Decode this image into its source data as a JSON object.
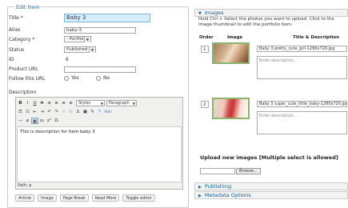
{
  "left": {
    "legend": "Edit Item",
    "fields": {
      "title_label": "Title",
      "title_req": "*",
      "title_value": "Baby 3",
      "alias_label": "Alias",
      "alias_value": "baby-3",
      "category_label": "Category",
      "category_req": "*",
      "category_value": "- Portfolio",
      "status_label": "Status",
      "status_value": "Published",
      "id_label": "ID",
      "id_value": "6",
      "product_url_label": "Product URL",
      "product_url_value": "",
      "follow_label": "Follow this URL",
      "follow_yes": "Yes",
      "follow_no": "No",
      "description_label": "Description"
    },
    "editor": {
      "style_select": "Styles",
      "format_select": "Paragraph",
      "content": "This is description for item baby 3",
      "path": "Path: p"
    },
    "buttons": [
      "Article",
      "Image",
      "Page Break",
      "Read More",
      "Toggle editor"
    ]
  },
  "right": {
    "images_header": "Images",
    "hint": "Hold Ctrl + Select the photos you want to upload. Click to the Image thumbnail to edit the portfolio item.",
    "col_order": "Order",
    "col_image": "Image",
    "col_title": "Title & Description",
    "rows": [
      {
        "order": "1",
        "filename": "Baby 3 pretty_cute_girl-1280x720.jpg",
        "desc_placeholder": "Enter description..."
      },
      {
        "order": "2",
        "filename": "Baby 3 super_cute_little_baby-1280x720.jpg",
        "desc_placeholder": "Enter description..."
      }
    ],
    "upload_title": "Upload new images [Multiple select is allowed]",
    "browse_label": "Browse...",
    "publishing_header": "Publishing",
    "metadata_header": "Metadata Options"
  }
}
